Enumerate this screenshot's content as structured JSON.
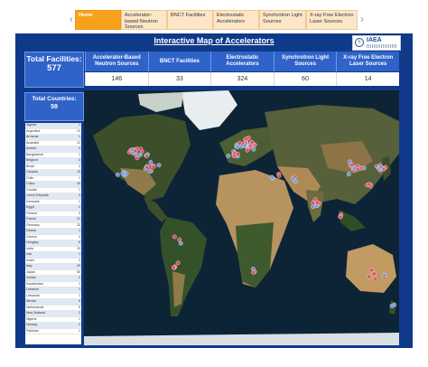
{
  "nav": {
    "tabs": [
      {
        "label": "Home",
        "active": true
      },
      {
        "label": "Accelerator-based Neutron Sources",
        "active": false
      },
      {
        "label": "BNCT Facilities",
        "active": false
      },
      {
        "label": "Electrostatic Accelerators",
        "active": false
      },
      {
        "label": "Synchrotron Light Sources",
        "active": false
      },
      {
        "label": "X-ray Free Electron Laser Sources",
        "active": false
      }
    ],
    "prev_icon": "chevron-left-icon",
    "next_icon": "chevron-right-icon"
  },
  "dashboard": {
    "title": "Interactive Map of Accelerators",
    "logo_text": "IAEA",
    "total_facilities_label": "Total Facilities:",
    "total_facilities_value": "577",
    "total_countries_label": "Total Countries:",
    "total_countries_value": "59"
  },
  "stats": [
    {
      "label": "Accelerator-Based Neutron Sources",
      "value": "146"
    },
    {
      "label": "BNCT Facilities",
      "value": "33"
    },
    {
      "label": "Electrostatic Accelerators",
      "value": "324"
    },
    {
      "label": "Synchrotron Light Sources",
      "value": "60"
    },
    {
      "label": "X-ray Free Electron Laser Sources",
      "value": "14"
    }
  ],
  "countries": [
    {
      "name": "Algeria",
      "count": "1"
    },
    {
      "name": "Argentina",
      "count": "13"
    },
    {
      "name": "Armenia",
      "count": "1"
    },
    {
      "name": "Australia",
      "count": "12"
    },
    {
      "name": "Austria",
      "count": "4"
    },
    {
      "name": "Bangladesh",
      "count": "1"
    },
    {
      "name": "Belgium",
      "count": "3"
    },
    {
      "name": "Brazil",
      "count": "3"
    },
    {
      "name": "Canada",
      "count": "15"
    },
    {
      "name": "Chile",
      "count": "1"
    },
    {
      "name": "China",
      "count": "40"
    },
    {
      "name": "Croatia",
      "count": "1"
    },
    {
      "name": "Czech Republic",
      "count": "4"
    },
    {
      "name": "Denmark",
      "count": "1"
    },
    {
      "name": "Egypt",
      "count": "2"
    },
    {
      "name": "Finland",
      "count": "3"
    },
    {
      "name": "France",
      "count": "21"
    },
    {
      "name": "Germany",
      "count": "33"
    },
    {
      "name": "Ghana",
      "count": "1"
    },
    {
      "name": "Greece",
      "count": "4"
    },
    {
      "name": "Hungary",
      "count": "6"
    },
    {
      "name": "India",
      "count": "23"
    },
    {
      "name": "Iran",
      "count": "1"
    },
    {
      "name": "Israel",
      "count": "3"
    },
    {
      "name": "Italy",
      "count": "29"
    },
    {
      "name": "Japan",
      "count": "50"
    },
    {
      "name": "Jordan",
      "count": "2"
    },
    {
      "name": "Kazakhstan",
      "count": "1"
    },
    {
      "name": "Lebanon",
      "count": "1"
    },
    {
      "name": "Lithuania",
      "count": "1"
    },
    {
      "name": "Mexico",
      "count": "6"
    },
    {
      "name": "Netherlands",
      "count": "5"
    },
    {
      "name": "New Zealand",
      "count": "2"
    },
    {
      "name": "Nigeria",
      "count": "1"
    },
    {
      "name": "Norway",
      "count": "2"
    },
    {
      "name": "Pakistan",
      "count": "1"
    }
  ],
  "map": {
    "attribution": "© 2023 Mapbox © OpenStreetMap",
    "colors": {
      "ocean": "#0d2436",
      "land_green": "#3d4f2a",
      "desert": "#b79360",
      "ice": "#e8edf0",
      "marker_red": "#e0506a",
      "marker_blue": "#6f9bd8"
    }
  }
}
